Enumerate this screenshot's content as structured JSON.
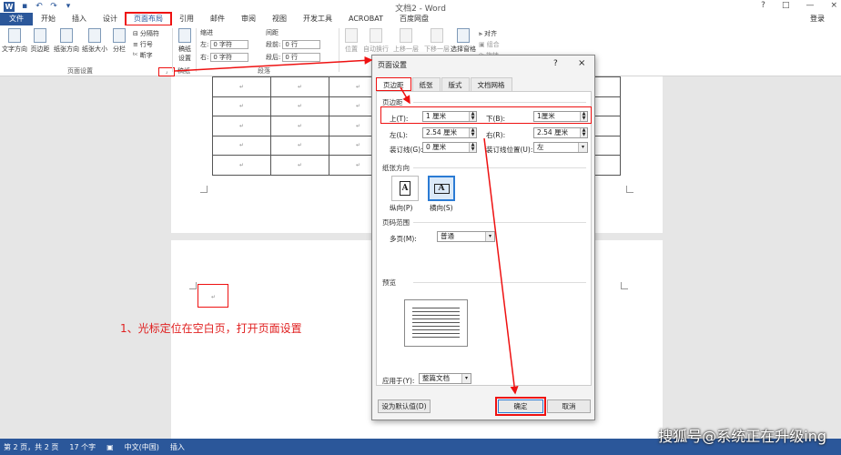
{
  "window": {
    "title": "文档2 - Word",
    "login": "登录",
    "help": "?",
    "restore": "□",
    "minimize": "—",
    "close": "×"
  },
  "tabs": [
    "文件",
    "开始",
    "插入",
    "设计",
    "页面布局",
    "引用",
    "邮件",
    "审阅",
    "视图",
    "开发工具",
    "ACROBAT",
    "百度网盘"
  ],
  "active_tab": "页面布局",
  "ribbon": {
    "page_setup_buttons": [
      "文字方向",
      "页边距",
      "纸张方向",
      "纸张大小",
      "分栏"
    ],
    "page_setup_small": [
      "分隔符",
      "行号",
      "断字"
    ],
    "page_setup_group": "页面设置",
    "manuscript": {
      "label1": "稿纸",
      "label2": "设置",
      "group": "稿纸"
    },
    "indent": {
      "header": "缩进",
      "left_label": "左:",
      "left_value": "0 字符",
      "right_label": "右:",
      "right_value": "0 字符"
    },
    "spacing": {
      "header": "间距",
      "before_label": "段前:",
      "before_value": "0 行",
      "after_label": "段后:",
      "after_value": "0 行"
    },
    "paragraph_group": "段落",
    "arrange_buttons": [
      "位置",
      "自动换行",
      "上移一层",
      "下移一层",
      "选择窗格"
    ],
    "arrange_small": [
      "对齐",
      "组合",
      "旋转"
    ]
  },
  "document": {
    "paragraph_mark": "↵",
    "table_rows": 5,
    "table_cols": 7
  },
  "annotation": "1、光标定位在空白页，打开页面设置",
  "statusbar": {
    "page": "第 2 页，共 2 页",
    "words": "17 个字",
    "lang": "中文(中国)",
    "mode": "插入"
  },
  "watermark": "搜狐号@系统正在升级ing",
  "dialog": {
    "title": "页面设置",
    "help": "?",
    "close": "×",
    "tabs": [
      "页边距",
      "纸张",
      "版式",
      "文档网格"
    ],
    "active_tab": "页边距",
    "margins_section": "页边距",
    "top_label": "上(T):",
    "top_value": "1 厘米",
    "bottom_label": "下(B):",
    "bottom_value": "1厘米",
    "left_label": "左(L):",
    "left_value": "2.54 厘米",
    "right_label": "右(R):",
    "right_value": "2.54 厘米",
    "gutter_label": "装订线(G):",
    "gutter_value": "0 厘米",
    "gutter_pos_label": "装订线位置(U):",
    "gutter_pos_value": "左",
    "orientation_section": "纸张方向",
    "portrait": "纵向(P)",
    "landscape": "横向(S)",
    "pages_section": "页码范围",
    "multi_label": "多页(M):",
    "multi_value": "普通",
    "preview_section": "预览",
    "apply_label": "应用于(Y):",
    "apply_value": "整篇文档",
    "default_button": "设为默认值(D)",
    "ok_button": "确定",
    "cancel_button": "取消"
  },
  "colors": {
    "word_blue": "#2b579a",
    "annotation_red": "#e11111"
  }
}
